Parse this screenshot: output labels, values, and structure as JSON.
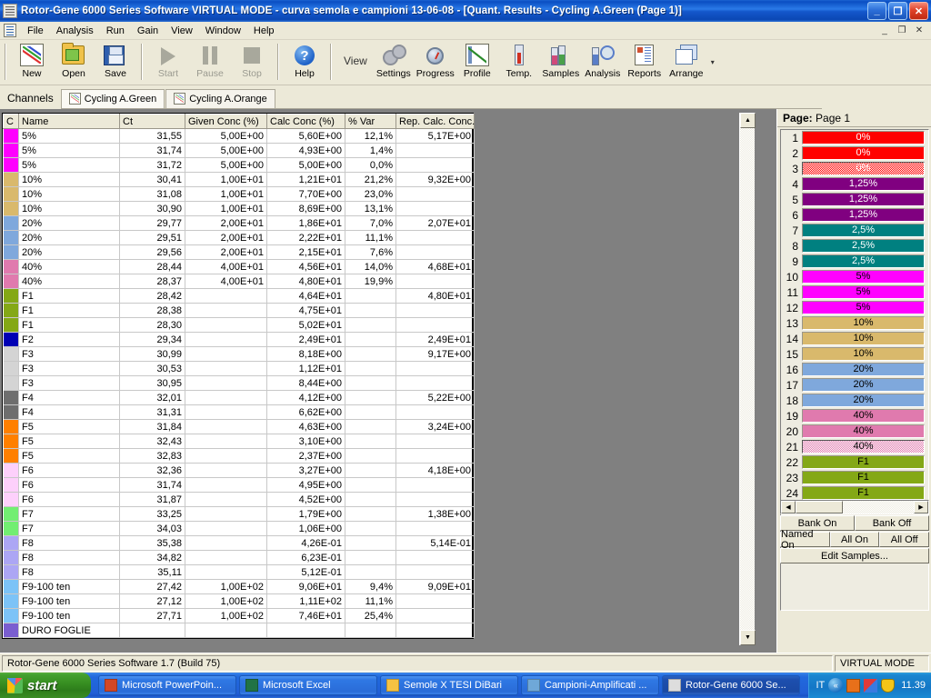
{
  "window": {
    "title": "Rotor-Gene 6000 Series Software VIRTUAL MODE - curva semola e campioni 13-06-08 - [Quant. Results - Cycling A.Green (Page 1)]",
    "minimize_label": "_",
    "restore_label": "❐",
    "close_label": "✕",
    "mdi_minimize": "_",
    "mdi_restore": "❐",
    "mdi_close": "✕",
    "titlebar_color": "#0a4ec2"
  },
  "menu": {
    "items": [
      "File",
      "Analysis",
      "Run",
      "Gain",
      "View",
      "Window",
      "Help"
    ]
  },
  "toolbar": {
    "view_label": "View",
    "dropdown_label": "▾",
    "buttons": [
      {
        "label": "New",
        "icon": "new-graph-icon",
        "disabled": false
      },
      {
        "label": "Open",
        "icon": "open-folder-icon",
        "disabled": false
      },
      {
        "label": "Save",
        "icon": "save-disk-icon",
        "disabled": false
      },
      {
        "label": "Start",
        "icon": "play-icon",
        "disabled": true
      },
      {
        "label": "Pause",
        "icon": "pause-icon",
        "disabled": true
      },
      {
        "label": "Stop",
        "icon": "stop-icon",
        "disabled": true
      },
      {
        "label": "Help",
        "icon": "help-icon",
        "disabled": false
      },
      {
        "label": "Settings",
        "icon": "gears-icon",
        "disabled": false
      },
      {
        "label": "Progress",
        "icon": "stopwatch-icon",
        "disabled": false
      },
      {
        "label": "Profile",
        "icon": "profile-chart-icon",
        "disabled": false
      },
      {
        "label": "Temp.",
        "icon": "thermometer-icon",
        "disabled": false
      },
      {
        "label": "Samples",
        "icon": "tubes-icon",
        "disabled": false
      },
      {
        "label": "Analysis",
        "icon": "analysis-icon",
        "disabled": false
      },
      {
        "label": "Reports",
        "icon": "reports-icon",
        "disabled": false
      },
      {
        "label": "Arrange",
        "icon": "arrange-windows-icon",
        "disabled": false
      }
    ]
  },
  "channels": {
    "label": "Channels",
    "tabs": [
      {
        "label": "Cycling A.Green",
        "active": true
      },
      {
        "label": "Cycling A.Orange",
        "active": false
      }
    ]
  },
  "grid": {
    "columns": [
      "C",
      "Name",
      "Ct",
      "Given Conc (%)",
      "Calc Conc (%)",
      "% Var",
      "Rep. Calc. Conc."
    ],
    "rows": [
      {
        "color": "#ff00ff",
        "name": "5%",
        "ct": "31,55",
        "given": "5,00E+00",
        "calc": "5,60E+00",
        "var": "12,1%",
        "rep": "5,17E+00"
      },
      {
        "color": "#ff00ff",
        "name": "5%",
        "ct": "31,74",
        "given": "5,00E+00",
        "calc": "4,93E+00",
        "var": "1,4%",
        "rep": ""
      },
      {
        "color": "#ff00ff",
        "name": "5%",
        "ct": "31,72",
        "given": "5,00E+00",
        "calc": "5,00E+00",
        "var": "0,0%",
        "rep": ""
      },
      {
        "color": "#d9b96c",
        "name": "10%",
        "ct": "30,41",
        "given": "1,00E+01",
        "calc": "1,21E+01",
        "var": "21,2%",
        "rep": "9,32E+00"
      },
      {
        "color": "#d9b96c",
        "name": "10%",
        "ct": "31,08",
        "given": "1,00E+01",
        "calc": "7,70E+00",
        "var": "23,0%",
        "rep": ""
      },
      {
        "color": "#d9b96c",
        "name": "10%",
        "ct": "30,90",
        "given": "1,00E+01",
        "calc": "8,69E+00",
        "var": "13,1%",
        "rep": ""
      },
      {
        "color": "#7fa8dc",
        "name": "20%",
        "ct": "29,77",
        "given": "2,00E+01",
        "calc": "1,86E+01",
        "var": "7,0%",
        "rep": "2,07E+01"
      },
      {
        "color": "#7fa8dc",
        "name": "20%",
        "ct": "29,51",
        "given": "2,00E+01",
        "calc": "2,22E+01",
        "var": "11,1%",
        "rep": ""
      },
      {
        "color": "#7fa8dc",
        "name": "20%",
        "ct": "29,56",
        "given": "2,00E+01",
        "calc": "2,15E+01",
        "var": "7,6%",
        "rep": ""
      },
      {
        "color": "#e07aae",
        "name": "40%",
        "ct": "28,44",
        "given": "4,00E+01",
        "calc": "4,56E+01",
        "var": "14,0%",
        "rep": "4,68E+01"
      },
      {
        "color": "#e07aae",
        "name": "40%",
        "ct": "28,37",
        "given": "4,00E+01",
        "calc": "4,80E+01",
        "var": "19,9%",
        "rep": ""
      },
      {
        "color": "#84a816",
        "name": "F1",
        "ct": "28,42",
        "given": "",
        "calc": "4,64E+01",
        "var": "",
        "rep": "4,80E+01"
      },
      {
        "color": "#84a816",
        "name": "F1",
        "ct": "28,38",
        "given": "",
        "calc": "4,75E+01",
        "var": "",
        "rep": ""
      },
      {
        "color": "#84a816",
        "name": "F1",
        "ct": "28,30",
        "given": "",
        "calc": "5,02E+01",
        "var": "",
        "rep": ""
      },
      {
        "color": "#0000b4",
        "name": "F2",
        "ct": "29,34",
        "given": "",
        "calc": "2,49E+01",
        "var": "",
        "rep": "2,49E+01"
      },
      {
        "color": "#d4d4d4",
        "name": "F3",
        "ct": "30,99",
        "given": "",
        "calc": "8,18E+00",
        "var": "",
        "rep": "9,17E+00"
      },
      {
        "color": "#d4d4d4",
        "name": "F3",
        "ct": "30,53",
        "given": "",
        "calc": "1,12E+01",
        "var": "",
        "rep": ""
      },
      {
        "color": "#d4d4d4",
        "name": "F3",
        "ct": "30,95",
        "given": "",
        "calc": "8,44E+00",
        "var": "",
        "rep": ""
      },
      {
        "color": "#6e6e6e",
        "name": "F4",
        "ct": "32,01",
        "given": "",
        "calc": "4,12E+00",
        "var": "",
        "rep": "5,22E+00"
      },
      {
        "color": "#6e6e6e",
        "name": "F4",
        "ct": "31,31",
        "given": "",
        "calc": "6,62E+00",
        "var": "",
        "rep": ""
      },
      {
        "color": "#ff8000",
        "name": "F5",
        "ct": "31,84",
        "given": "",
        "calc": "4,63E+00",
        "var": "",
        "rep": "3,24E+00"
      },
      {
        "color": "#ff8000",
        "name": "F5",
        "ct": "32,43",
        "given": "",
        "calc": "3,10E+00",
        "var": "",
        "rep": ""
      },
      {
        "color": "#ff8000",
        "name": "F5",
        "ct": "32,83",
        "given": "",
        "calc": "2,37E+00",
        "var": "",
        "rep": ""
      },
      {
        "color": "#fdd0fb",
        "name": "F6",
        "ct": "32,36",
        "given": "",
        "calc": "3,27E+00",
        "var": "",
        "rep": "4,18E+00"
      },
      {
        "color": "#fdd0fb",
        "name": "F6",
        "ct": "31,74",
        "given": "",
        "calc": "4,95E+00",
        "var": "",
        "rep": ""
      },
      {
        "color": "#fdd0fb",
        "name": "F6",
        "ct": "31,87",
        "given": "",
        "calc": "4,52E+00",
        "var": "",
        "rep": ""
      },
      {
        "color": "#72ee72",
        "name": "F7",
        "ct": "33,25",
        "given": "",
        "calc": "1,79E+00",
        "var": "",
        "rep": "1,38E+00"
      },
      {
        "color": "#72ee72",
        "name": "F7",
        "ct": "34,03",
        "given": "",
        "calc": "1,06E+00",
        "var": "",
        "rep": ""
      },
      {
        "color": "#aca6f4",
        "name": "F8",
        "ct": "35,38",
        "given": "",
        "calc": "4,26E-01",
        "var": "",
        "rep": "5,14E-01"
      },
      {
        "color": "#aca6f4",
        "name": "F8",
        "ct": "34,82",
        "given": "",
        "calc": "6,23E-01",
        "var": "",
        "rep": ""
      },
      {
        "color": "#aca6f4",
        "name": "F8",
        "ct": "35,11",
        "given": "",
        "calc": "5,12E-01",
        "var": "",
        "rep": ""
      },
      {
        "color": "#7cc3f7",
        "name": "F9-100 ten",
        "ct": "27,42",
        "given": "1,00E+02",
        "calc": "9,06E+01",
        "var": "9,4%",
        "rep": "9,09E+01"
      },
      {
        "color": "#7cc3f7",
        "name": "F9-100 ten",
        "ct": "27,12",
        "given": "1,00E+02",
        "calc": "1,11E+02",
        "var": "11,1%",
        "rep": ""
      },
      {
        "color": "#7cc3f7",
        "name": "F9-100 ten",
        "ct": "27,71",
        "given": "1,00E+02",
        "calc": "7,46E+01",
        "var": "25,4%",
        "rep": ""
      },
      {
        "color": "#7a5ed0",
        "name": "DURO FOGLIE",
        "ct": "",
        "given": "",
        "calc": "",
        "var": "",
        "rep": ""
      }
    ]
  },
  "scrollbars": {
    "up_arrow": "▲",
    "down_arrow": "▼",
    "left_arrow": "◀",
    "right_arrow": "▶"
  },
  "side_panel": {
    "page_prefix": "Page:",
    "page_value": "Page 1",
    "samples": [
      {
        "num": "1",
        "label": "0%",
        "color": "#ff0000",
        "text_color": "#ffffff",
        "selected": false
      },
      {
        "num": "2",
        "label": "0%",
        "color": "#ff0000",
        "text_color": "#ffffff",
        "selected": false
      },
      {
        "num": "3",
        "label": "0%",
        "color": "#ff0000",
        "text_color": "#ffffff",
        "selected": true
      },
      {
        "num": "4",
        "label": "1,25%",
        "color": "#800080",
        "text_color": "#ffffff",
        "selected": false
      },
      {
        "num": "5",
        "label": "1,25%",
        "color": "#800080",
        "text_color": "#ffffff",
        "selected": false
      },
      {
        "num": "6",
        "label": "1,25%",
        "color": "#800080",
        "text_color": "#ffffff",
        "selected": false
      },
      {
        "num": "7",
        "label": "2,5%",
        "color": "#008080",
        "text_color": "#ffffff",
        "selected": false
      },
      {
        "num": "8",
        "label": "2,5%",
        "color": "#008080",
        "text_color": "#ffffff",
        "selected": false
      },
      {
        "num": "9",
        "label": "2,5%",
        "color": "#008080",
        "text_color": "#ffffff",
        "selected": false
      },
      {
        "num": "10",
        "label": "5%",
        "color": "#ff00ff",
        "text_color": "#000000",
        "selected": false
      },
      {
        "num": "11",
        "label": "5%",
        "color": "#ff00ff",
        "text_color": "#000000",
        "selected": false
      },
      {
        "num": "12",
        "label": "5%",
        "color": "#ff00ff",
        "text_color": "#000000",
        "selected": false
      },
      {
        "num": "13",
        "label": "10%",
        "color": "#d9b96c",
        "text_color": "#000000",
        "selected": false
      },
      {
        "num": "14",
        "label": "10%",
        "color": "#d9b96c",
        "text_color": "#000000",
        "selected": false
      },
      {
        "num": "15",
        "label": "10%",
        "color": "#d9b96c",
        "text_color": "#000000",
        "selected": false
      },
      {
        "num": "16",
        "label": "20%",
        "color": "#7fa8dc",
        "text_color": "#000000",
        "selected": false
      },
      {
        "num": "17",
        "label": "20%",
        "color": "#7fa8dc",
        "text_color": "#000000",
        "selected": false
      },
      {
        "num": "18",
        "label": "20%",
        "color": "#7fa8dc",
        "text_color": "#000000",
        "selected": false
      },
      {
        "num": "19",
        "label": "40%",
        "color": "#e07aae",
        "text_color": "#000000",
        "selected": false
      },
      {
        "num": "20",
        "label": "40%",
        "color": "#e07aae",
        "text_color": "#000000",
        "selected": false
      },
      {
        "num": "21",
        "label": "40%",
        "color": "#e07aae",
        "text_color": "#000000",
        "selected": true
      },
      {
        "num": "22",
        "label": "F1",
        "color": "#84a816",
        "text_color": "#000000",
        "selected": false
      },
      {
        "num": "23",
        "label": "F1",
        "color": "#84a816",
        "text_color": "#000000",
        "selected": false
      },
      {
        "num": "24",
        "label": "F1",
        "color": "#84a816",
        "text_color": "#000000",
        "selected": false
      }
    ],
    "buttons": [
      {
        "label": "Bank On"
      },
      {
        "label": "Bank Off"
      },
      {
        "label": "Named On"
      },
      {
        "label": "All On"
      },
      {
        "label": "All Off"
      },
      {
        "label": "Edit Samples..."
      }
    ]
  },
  "statusbar": {
    "message": "Rotor-Gene 6000 Series Software 1.7 (Build 75)",
    "mode": "VIRTUAL MODE"
  },
  "taskbar": {
    "start_label": "start",
    "tasks": [
      {
        "label": "Microsoft PowerPoin...",
        "icon_color": "#d24726",
        "active": false
      },
      {
        "label": "Microsoft Excel",
        "icon_color": "#217346",
        "active": false
      },
      {
        "label": "Semole X TESI DiBari",
        "icon_color": "#f5c242",
        "active": false
      },
      {
        "label": "Campioni-Amplificati ...",
        "icon_color": "#6fa8d8",
        "active": false
      },
      {
        "label": "Rotor-Gene 6000 Se...",
        "icon_color": "#dddddd",
        "active": true
      }
    ],
    "tray": {
      "language": "IT",
      "chevron": "«",
      "icons": [
        "java-icon",
        "windows-update-icon",
        "security-shield-icon"
      ],
      "time": "11.39"
    }
  }
}
